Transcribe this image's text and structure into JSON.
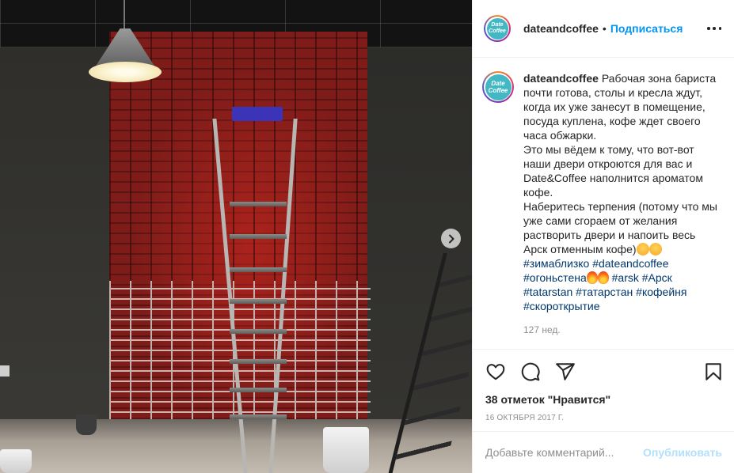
{
  "post": {
    "username": "dateandcoffee",
    "separator": "•",
    "follow_label": "Подписаться",
    "avatar_text": [
      "Date",
      "Coffee"
    ],
    "caption": {
      "username": "dateandcoffee",
      "lines": [
        "Рабочая зона бариста почти готова, столы и кресла ждут, когда их уже занесут в помещение, посуда куплена, кофе ждет своего часа обжарки.",
        "Это мы вёдем к тому, что вот-вот наши двери откроются для вас и Date&Coffee наполнится ароматом кофе.",
        "Наберитесь терпения (потому что мы уже сами сгораем от желания растворить двери и напоить весь Арск отменным кофе)"
      ],
      "hashtags": {
        "zimablizko": "#зимаблизко",
        "dateandcoffee": "#dateandcoffee",
        "ogonstena": "#огоньстена",
        "arsk_lat": "#arsk",
        "arsk": "#Арск",
        "tatarstan_lat": "#tatarstan",
        "tatarstan": "#татарстан",
        "kofeinya": "#кофейня",
        "skorootkrytie": "#скороткрытие"
      },
      "time_ago": "127 нед."
    },
    "likes": "38 отметок \"Нравится\"",
    "date": "16 ОКТЯБРЯ 2017 Г.",
    "comment_placeholder": "Добавьте комментарий...",
    "publish_label": "Опубликовать"
  },
  "icons": {
    "like": "heart-icon",
    "comment": "comment-icon",
    "share": "share-icon",
    "save": "bookmark-icon",
    "next": "chevron-right-icon",
    "more": "more-options-icon"
  },
  "colors": {
    "follow": "#0095f6",
    "hashtag": "#00376b",
    "publish_disabled": "#b2dffc",
    "secondary_text": "#8e8e8e"
  }
}
